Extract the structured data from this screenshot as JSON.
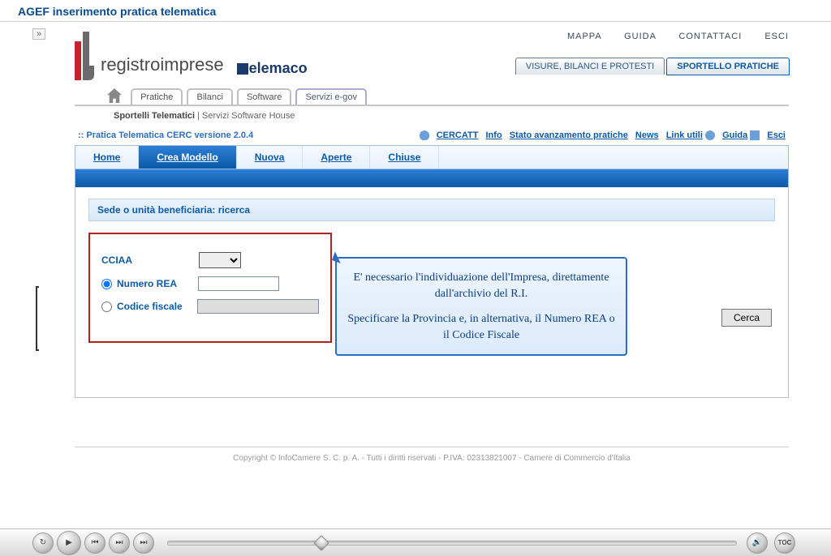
{
  "title": "AGEF inserimento pratica telematica",
  "expand_glyph": "»",
  "logo": {
    "text": "registroimprese",
    "telemaco": "elemaco"
  },
  "top_nav": {
    "mappa": "MAPPA",
    "guida": "GUIDA",
    "contattaci": "CONTATTACI",
    "esci": "ESCI"
  },
  "sub_tabs": {
    "visure": "VISURE, BILANCI E PROTESTI",
    "sportello": "SPORTELLO PRATICHE"
  },
  "main_tabs": {
    "pratiche": "Pratiche",
    "bilanci": "Bilanci",
    "software": "Software",
    "servizi": "Servizi e-gov"
  },
  "sub_line": {
    "bold": "Sportelli Telematici",
    "sep": " | ",
    "rest": "Servizi Software House"
  },
  "version_line": ":: Pratica Telematica CERC versione 2.0.4",
  "toolbar": {
    "cercatt": "CERCATT",
    "info": "Info",
    "stato": "Stato avanzamento pratiche",
    "news": "News",
    "link": "Link utili",
    "guida": "Guida",
    "esci": "Esci"
  },
  "blue_tabs": {
    "home": "Home",
    "crea": "Crea Modello",
    "nuova": "Nuova",
    "aperte": "Aperte",
    "chiuse": "Chiuse"
  },
  "panel": {
    "title": "Sede o unità beneficiaria: ricerca",
    "cciaa_label": "CCIAA",
    "rea_label": "Numero REA",
    "cf_label": "Codice fiscale",
    "cerca": "Cerca"
  },
  "callout": {
    "line1": "E' necessario l'individuazione dell'Impresa, direttamente dall'archivio del R.I.",
    "line2": "Specificare la Provincia e, in alternativa, il Numero REA o il Codice Fiscale"
  },
  "footer": "Copyright © InfoCamere S. C. p. A. - Tutti i diritti riservati - P.IVA: 02313821007 - Camere di Commercio d'Italia",
  "player": {
    "refresh": "↻",
    "play": "▶",
    "back": "⏮",
    "step": "⏭",
    "fwd": "⏭",
    "vol": "🔊",
    "toc": "TOC"
  }
}
